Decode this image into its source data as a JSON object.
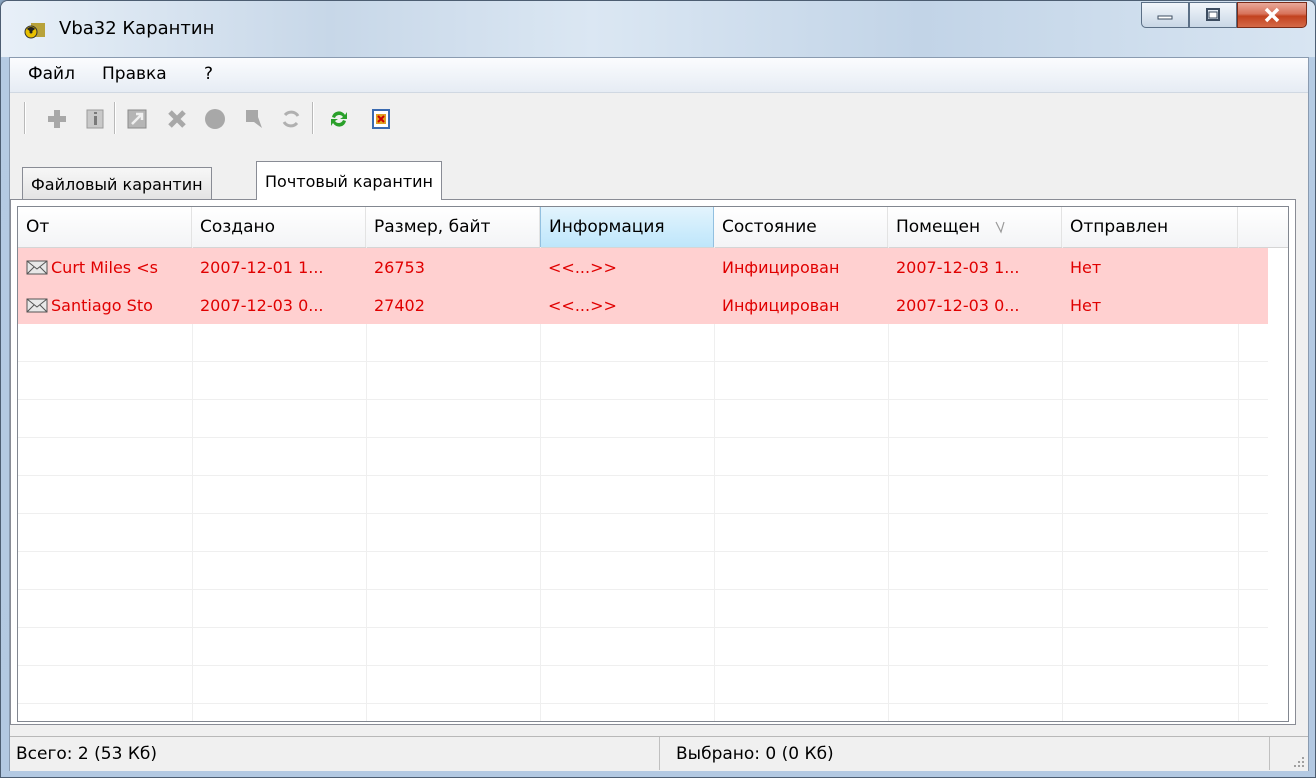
{
  "window": {
    "title": "Vba32 Карантин"
  },
  "menu": {
    "items": [
      "Файл",
      "Правка",
      "?"
    ]
  },
  "toolbar": {
    "buttons": [
      {
        "icon": "plus-icon",
        "enabled": false
      },
      {
        "icon": "info-icon",
        "enabled": false
      },
      {
        "icon": "export-icon",
        "enabled": false
      },
      {
        "icon": "delete-icon",
        "enabled": false
      },
      {
        "icon": "circle-icon",
        "enabled": false
      },
      {
        "icon": "restore-icon",
        "enabled": false
      },
      {
        "icon": "rescan-icon",
        "enabled": false
      },
      {
        "icon": "refresh-icon",
        "enabled": true
      },
      {
        "icon": "report-icon",
        "enabled": true
      }
    ]
  },
  "tabs": [
    {
      "label": "Файловый карантин",
      "active": false
    },
    {
      "label": "Почтовый карантин",
      "active": true
    }
  ],
  "table": {
    "columns": [
      "От",
      "Создано",
      "Размер, байт",
      "Информация",
      "Состояние",
      "Помещен",
      "Отправлен"
    ],
    "sorted_column": "Информация",
    "rows": [
      {
        "from": "Curt Miles <s",
        "created": "2007-12-01 1...",
        "size": "26753",
        "info": "<<...>>",
        "state": "Инфицирован",
        "placed": "2007-12-03 1...",
        "sent": "Нет"
      },
      {
        "from": "Santiago Sto",
        "created": "2007-12-03 0...",
        "size": "27402",
        "info": "<<...>>",
        "state": "Инфицирован",
        "placed": "2007-12-03 0...",
        "sent": "Нет"
      }
    ]
  },
  "status": {
    "total": "Всего: 2 (53 Кб)",
    "selected": "Выбрано: 0 (0 Кб)"
  },
  "colors": {
    "infected_row": "#ffd0d0",
    "infected_text": "#e00000",
    "sorted_header": "#bee6fb"
  }
}
